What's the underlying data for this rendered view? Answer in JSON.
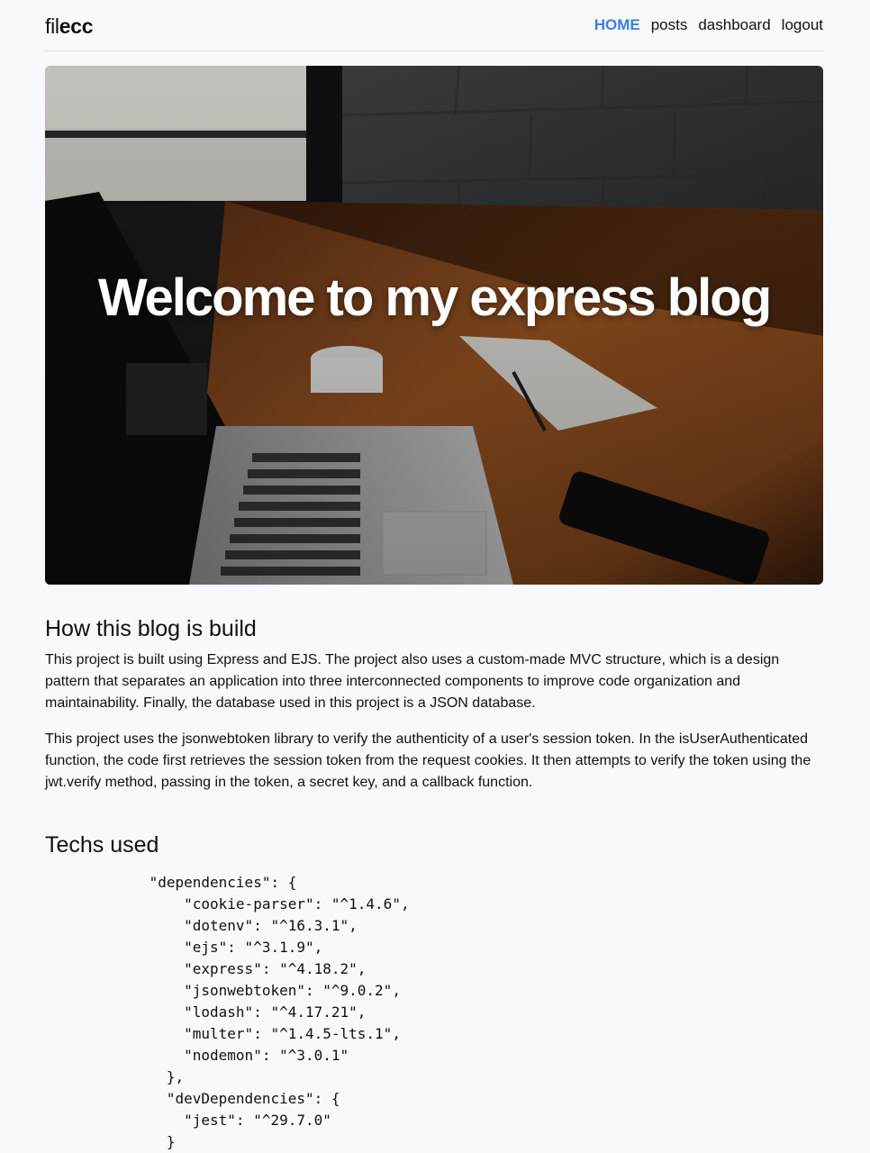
{
  "brand": {
    "logo_light": "fil",
    "logo_bold": "ecc"
  },
  "nav": {
    "items": [
      "HOME",
      "posts",
      "dashboard",
      "logout"
    ]
  },
  "hero": {
    "title": "Welcome to my express blog"
  },
  "sections": [
    {
      "title": "How this blog is build",
      "paragraphs": [
        "This project is built using Express and EJS. The project also uses a custom-made MVC structure, which is a design pattern that separates an application into three interconnected components to improve code organization and maintainability. Finally, the database used in this project is a JSON database.",
        "This project uses the jsonwebtoken library to verify the authenticity of a user's session token. In the isUserAuthenticated function, the code first retrieves the session token from the request cookies. It then attempts to verify the token using the jwt.verify method, passing in the token, a secret key, and a callback function."
      ]
    },
    {
      "title": "Techs used",
      "code": "            \"dependencies\": {\n                \"cookie-parser\": \"^1.4.6\",\n                \"dotenv\": \"^16.3.1\",\n                \"ejs\": \"^3.1.9\",\n                \"express\": \"^4.18.2\",\n                \"jsonwebtoken\": \"^9.0.2\",\n                \"lodash\": \"^4.17.21\",\n                \"multer\": \"^1.4.5-lts.1\",\n                \"nodemon\": \"^3.0.1\"\n              },\n              \"devDependencies\": {\n                \"jest\": \"^29.7.0\"\n              }"
    }
  ]
}
